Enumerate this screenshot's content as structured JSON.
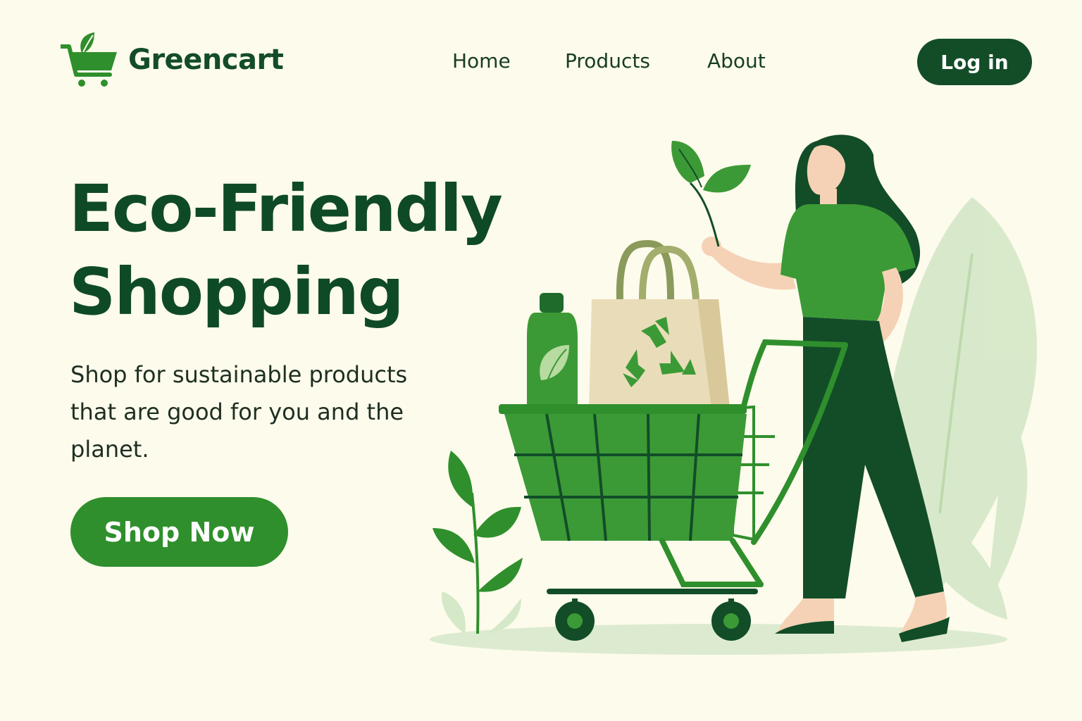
{
  "brand": {
    "name": "Greencart",
    "logo_icon": "shopping-cart-leaf-icon"
  },
  "nav": {
    "items": [
      {
        "label": "Home"
      },
      {
        "label": "Products"
      },
      {
        "label": "About"
      }
    ],
    "login_label": "Log in"
  },
  "hero": {
    "title_line1": "Eco-Friendly",
    "title_line2": "Shopping",
    "description": "Shop for sustainable products that are good for you and the planet.",
    "cta_label": "Shop Now"
  },
  "illustration": {
    "subject": "woman-with-shopping-cart-illustration",
    "items": [
      "green-bottle-icon",
      "recycle-bag-icon",
      "leaf-sprig-icon",
      "plant-icon"
    ]
  },
  "colors": {
    "background": "#fdfbec",
    "primary_dark": "#124d28",
    "primary": "#2f8f2c",
    "accent_light": "#d5e8c8"
  }
}
